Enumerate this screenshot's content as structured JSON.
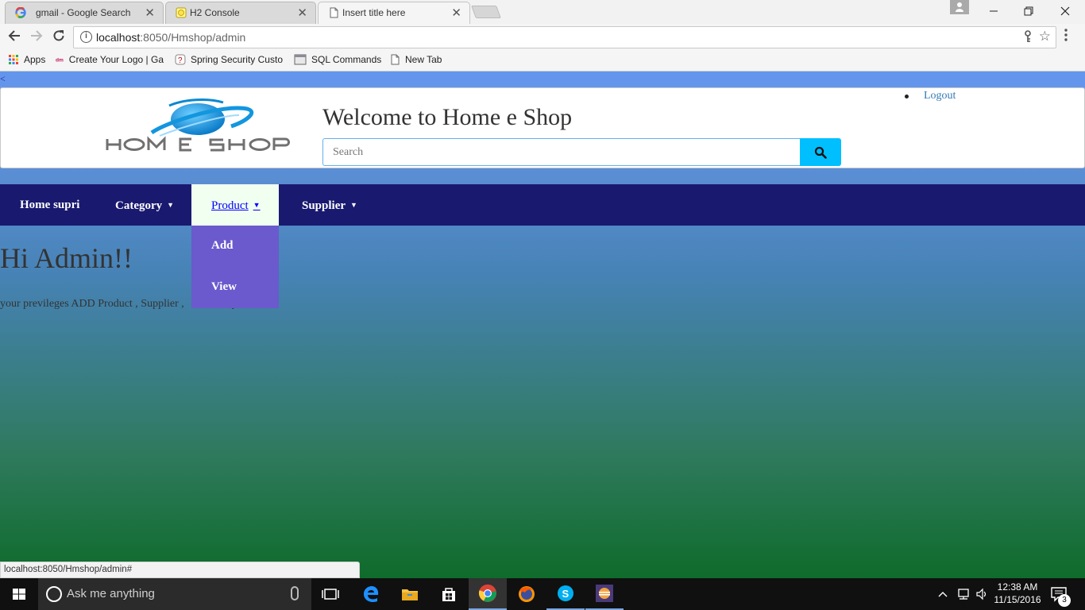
{
  "browser": {
    "tabs": [
      {
        "label": "gmail - Google Search",
        "icon": "google-icon"
      },
      {
        "label": "H2 Console",
        "icon": "h2-icon"
      },
      {
        "label": "Insert title here",
        "icon": "page-icon",
        "active": true
      }
    ],
    "close_glyph": "✕",
    "url_host": "localhost",
    "url_path": ":8050/Hmshop/admin",
    "bookmarks": [
      {
        "label": "Apps",
        "icon": "apps-grid-icon"
      },
      {
        "label": "Create Your Logo | Ga",
        "icon": "dm-icon"
      },
      {
        "label": "Spring Security Custo",
        "icon": "spring-icon"
      },
      {
        "label": "SQL Commands",
        "icon": "sql-icon"
      },
      {
        "label": "New Tab",
        "icon": "page-icon"
      }
    ],
    "status_url": "localhost:8050/Hmshop/admin#"
  },
  "page": {
    "lt_text": "<",
    "logo_text": "HOM E SHOP",
    "welcome": "Welcome to Home e Shop",
    "search_placeholder": "Search",
    "logout": "Logout",
    "nav": {
      "home": "Home supri",
      "category": "Category",
      "product": "Product",
      "supplier": "Supplier",
      "caret": "▼"
    },
    "product_menu": {
      "add": "Add",
      "view": "View"
    },
    "greeting": "Hi Admin!!",
    "privileges_visible": "your previleges ADD Product , Supplier ,",
    "privileges_tail": "y"
  },
  "taskbar": {
    "search_text": "Ask me anything",
    "time": "12:38 AM",
    "date": "11/15/2016",
    "notifications": "3"
  },
  "colors": {
    "page_gradient_top": "#6495ed",
    "page_gradient_bottom": "#0f6b2b",
    "navbar": "#191970",
    "active_nav_bg": "#f0fff0",
    "dropdown_bg": "#6a5acd",
    "search_button": "#00bfff",
    "link": "#337ab7"
  }
}
